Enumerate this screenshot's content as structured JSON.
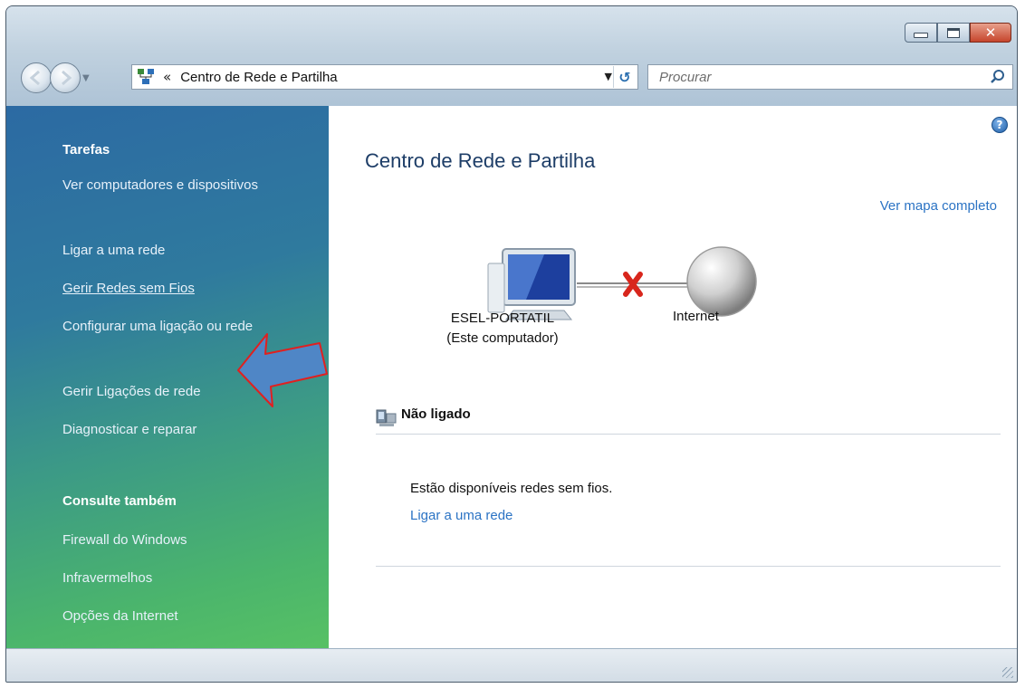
{
  "window": {
    "caption_buttons": {
      "minimize_icon": "minimize-icon",
      "maximize_icon": "maximize-icon",
      "close_glyph": "✕"
    }
  },
  "navigation": {
    "back_icon": "back-arrow-icon",
    "forward_icon": "forward-arrow-icon",
    "address": {
      "chevron": "«",
      "path": "Centro de Rede e Partilha"
    },
    "refresh_glyph": "↺",
    "search": {
      "placeholder": "Procurar"
    }
  },
  "sidebar": {
    "tasks_heading": "Tarefas",
    "tasks": [
      {
        "label": "Ver computadores e dispositivos"
      },
      {
        "label": "Ligar a uma rede"
      },
      {
        "label": "Gerir Redes sem Fios"
      },
      {
        "label": "Configurar uma ligação ou rede"
      },
      {
        "label": "Gerir Ligações de rede"
      },
      {
        "label": "Diagnosticar e reparar"
      }
    ],
    "see_also_heading": "Consulte também",
    "see_also": [
      {
        "label": "Firewall do Windows"
      },
      {
        "label": "Infravermelhos"
      },
      {
        "label": "Opções da Internet"
      }
    ]
  },
  "main": {
    "help_glyph": "?",
    "title": "Centro de Rede e Partilha",
    "full_map_link": "Ver mapa completo",
    "computer_name": "ESEL-PORTATIL",
    "computer_sub": "(Este computador)",
    "internet_label": "Internet",
    "status_section_title": "Não ligado",
    "status_message": "Estão disponíveis redes sem fios.",
    "connect_link": "Ligar a uma rede"
  },
  "colors": {
    "link": "#2b73c4",
    "title": "#1d3d67",
    "error_x": "#d8261c",
    "annotation_arrow_fill": "#4f86c6",
    "annotation_arrow_stroke": "#e02020"
  }
}
